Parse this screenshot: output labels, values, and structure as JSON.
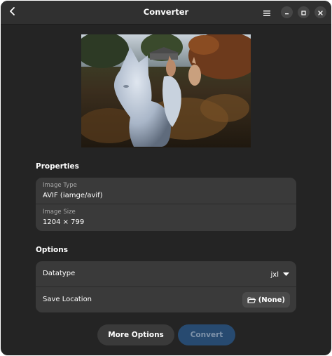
{
  "window": {
    "title": "Converter"
  },
  "header": {
    "icons": {
      "back": "back-arrow-icon",
      "menu": "hamburger-menu-icon",
      "minimize": "minimize-icon",
      "maximize": "maximize-icon",
      "close": "close-icon"
    }
  },
  "preview": {
    "description_icon": "image-preview"
  },
  "properties": {
    "section_title": "Properties",
    "image_type_label": "Image Type",
    "image_type_value": "AVIF (iamge/avif)",
    "image_size_label": "Image Size",
    "image_size_value": "1204 × 799"
  },
  "options": {
    "section_title": "Options",
    "datatype_label": "Datatype",
    "datatype_value": "jxl",
    "save_location_label": "Save Location",
    "save_location_value": "(None)"
  },
  "actions": {
    "more_options_label": "More Options",
    "convert_label": "Convert"
  },
  "colors": {
    "window_bg": "#242424",
    "headerbar_bg": "#303030",
    "card_bg": "#3a3a3a",
    "more_options_bg": "#3a3a3a",
    "convert_bg": "#274a70",
    "convert_text": "#7f93aa"
  }
}
